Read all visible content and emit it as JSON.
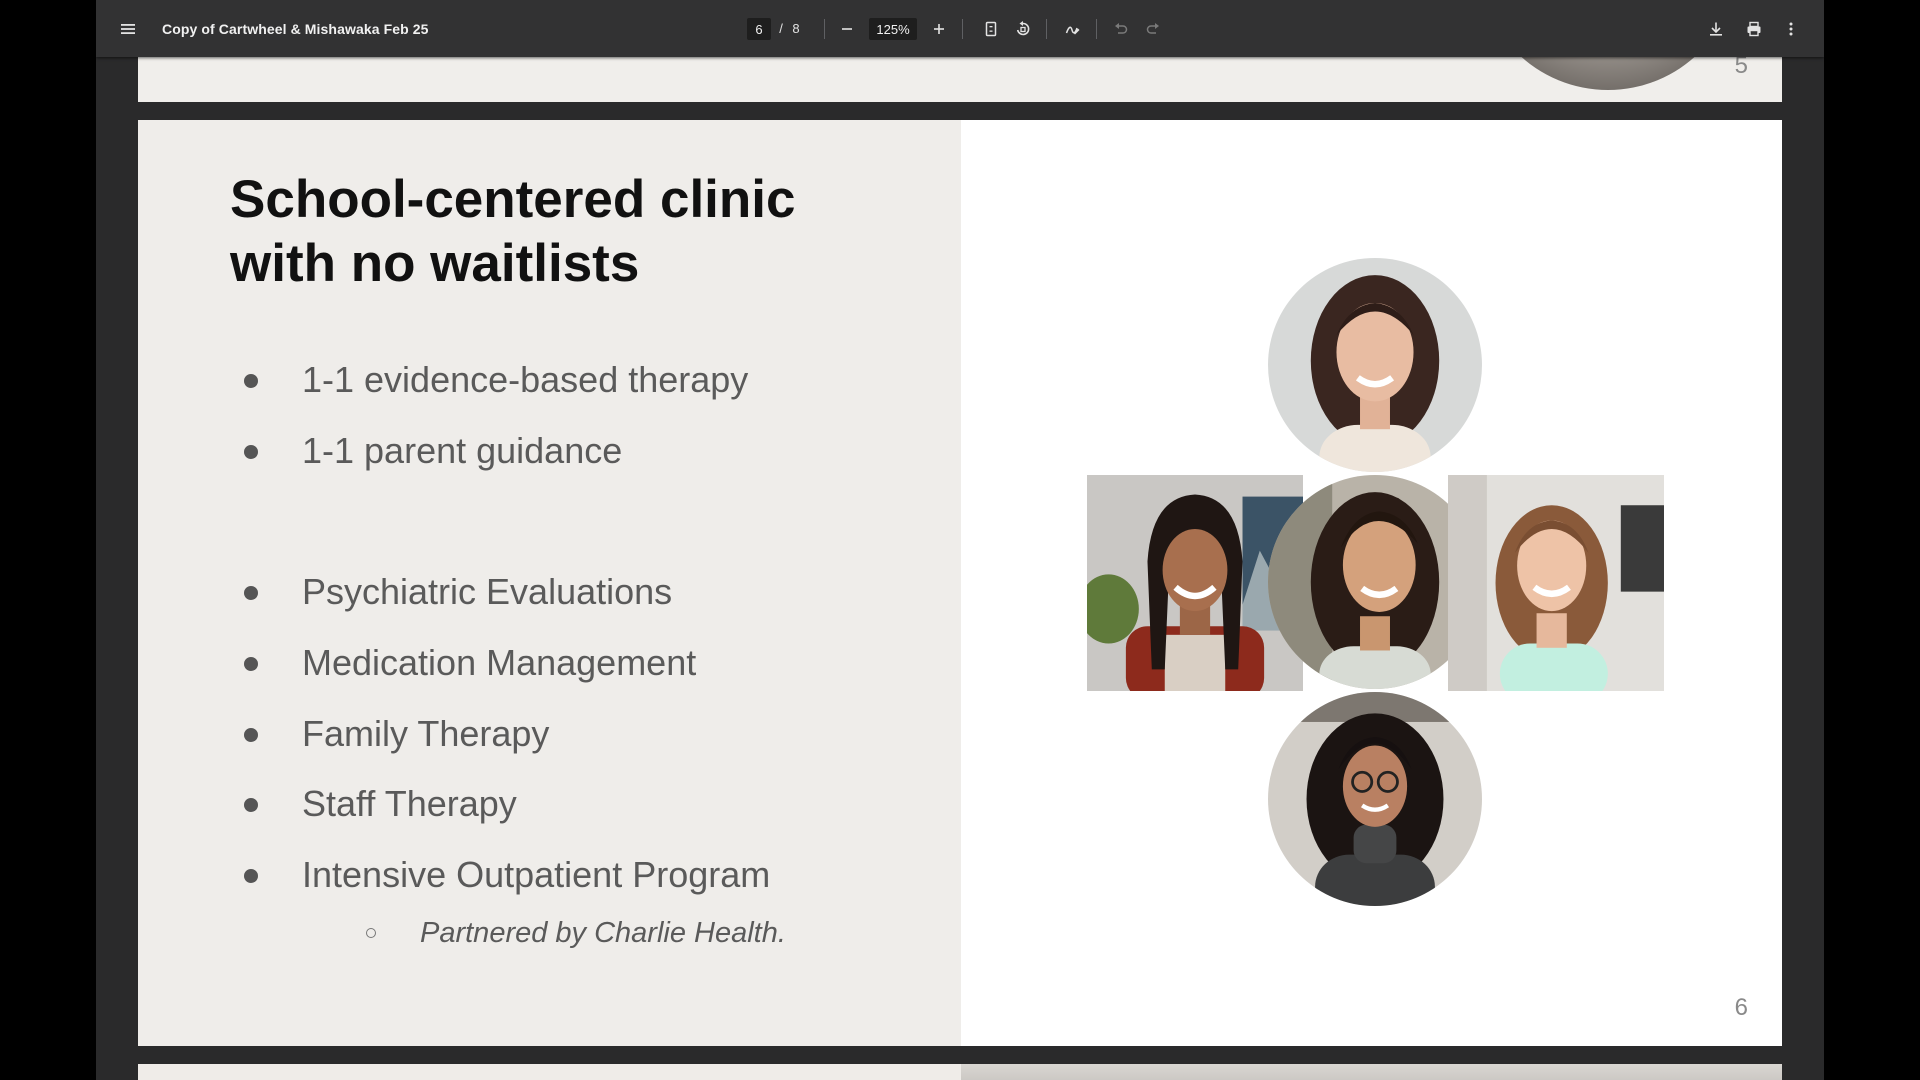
{
  "toolbar": {
    "title": "Copy of Cartwheel & Mishawaka Feb 25",
    "current_page": "6",
    "page_separator": "/",
    "total_pages": "8",
    "zoom": "125%",
    "icons": [
      "menu-icon",
      "zoom-out-icon",
      "zoom-in-icon",
      "fit-page-icon",
      "rotate-icon",
      "annotate-icon",
      "undo-icon",
      "redo-icon",
      "download-icon",
      "print-icon",
      "more-options-icon"
    ]
  },
  "pages": {
    "previous": {
      "page_number": "5"
    },
    "current": {
      "page_number": "6",
      "title_line1": "School-centered clinic",
      "title_line2": "with no waitlists",
      "bullets": [
        "1-1 evidence-based therapy",
        "1-1 parent guidance",
        "Psychiatric Evaluations",
        "Medication Management",
        "Family Therapy",
        "Staff Therapy",
        "Intensive Outpatient Program"
      ],
      "sub_bullet": "Partnered by Charlie Health."
    }
  },
  "colors": {
    "toolbar_bg": "#323233",
    "viewer_bg": "#2a2a2b",
    "slide_left_bg": "#efedea",
    "slide_right_bg": "#ffffff",
    "title_text": "#111111",
    "bullet_text": "#5a5a5a"
  }
}
